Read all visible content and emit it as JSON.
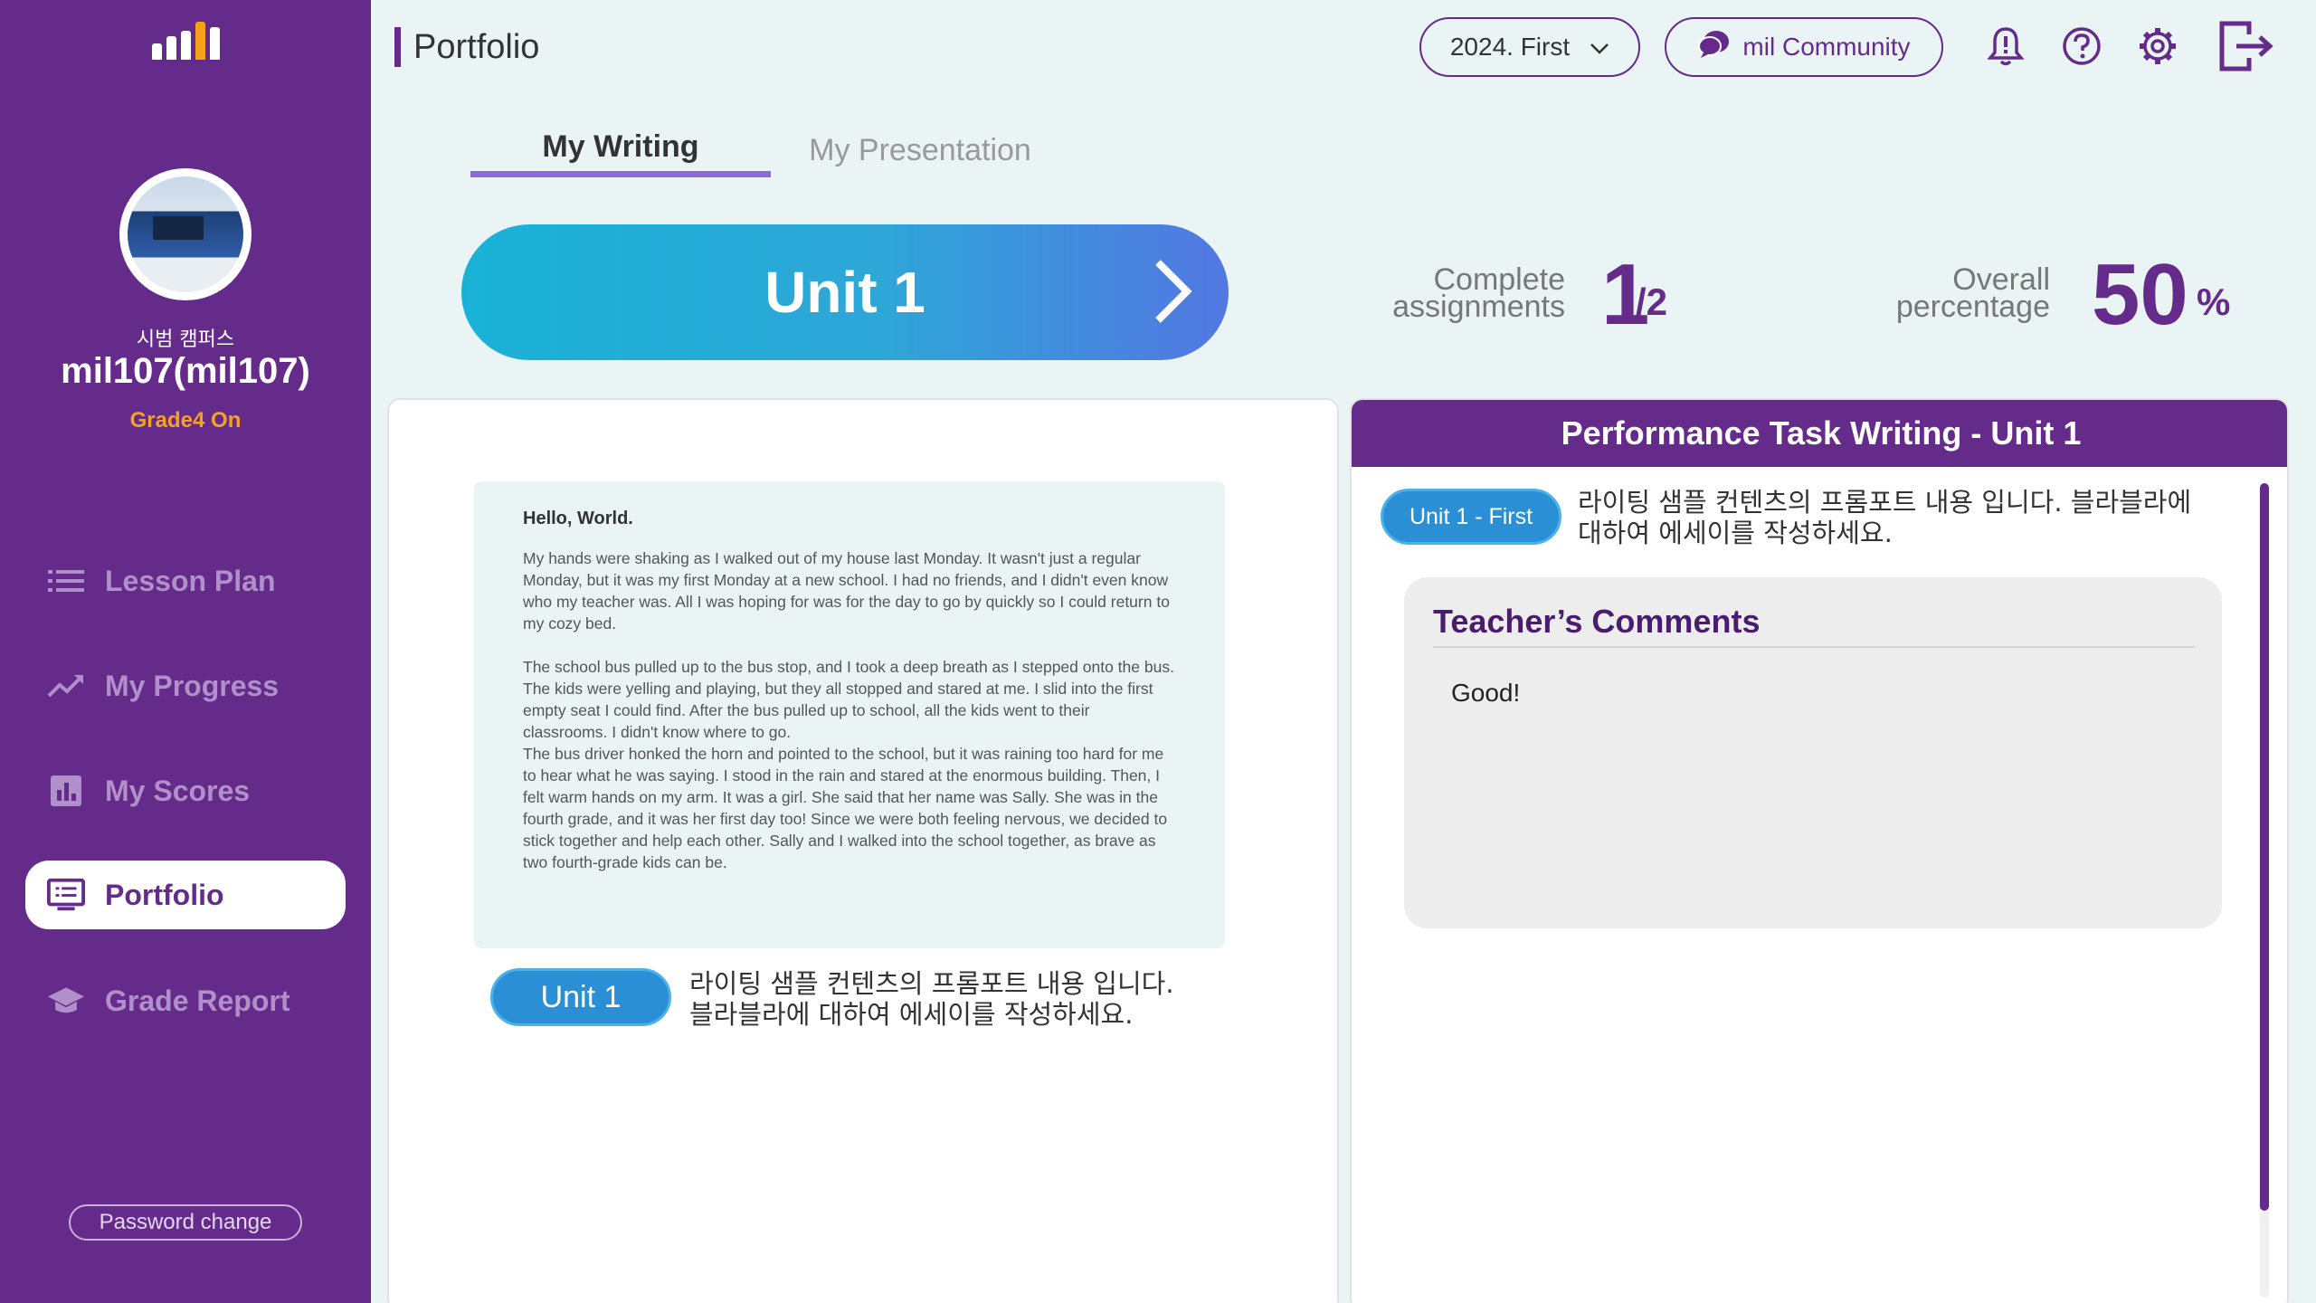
{
  "sidebar": {
    "campus": "시범 캠퍼스",
    "username": "mil107(mil107)",
    "grade": "Grade4 On",
    "nav": [
      {
        "label": "Lesson Plan",
        "icon": "list-icon"
      },
      {
        "label": "My Progress",
        "icon": "trend-up-icon"
      },
      {
        "label": "My Scores",
        "icon": "bar-chart-icon"
      },
      {
        "label": "Portfolio",
        "icon": "monitor-list-icon",
        "active": true
      },
      {
        "label": "Grade Report",
        "icon": "graduation-cap-icon"
      }
    ],
    "password_change": "Password change"
  },
  "header": {
    "title": "Portfolio",
    "semester": "2024. First",
    "community": "mil Community",
    "icons": [
      "bell-icon",
      "help-icon",
      "gear-icon",
      "logout-icon"
    ]
  },
  "tabs": [
    {
      "label": "My Writing",
      "active": true
    },
    {
      "label": "My Presentation",
      "active": false
    }
  ],
  "unit_banner": {
    "label": "Unit 1"
  },
  "stats": {
    "complete_label_line1": "Complete",
    "complete_label_line2": "assignments",
    "complete_done": "1",
    "complete_total": "/2",
    "overall_label_line1": "Overall",
    "overall_label_line2": "percentage",
    "overall_value": "50",
    "overall_unit": "%"
  },
  "essay": {
    "title": "Hello, World.",
    "paragraph1": "My hands were shaking as I walked out of my house last Monday. It wasn't just a regular Monday, but it was my first Monday at a new school. I had no friends, and I didn't even know who my teacher was. All I was hoping for was for the day to go by quickly so I could return to my cozy bed.",
    "paragraph2": "The school bus pulled up to the bus stop, and I took a deep breath as I stepped onto the bus. The kids were yelling and playing, but they all stopped and stared at me. I slid into the first empty seat I could find. After the bus pulled up to school, all the kids went to their classrooms. I didn't know where to go.\nThe bus driver honked the horn and pointed to the school, but it was raining too hard for me to hear what he was saying. I stood in the rain and stared at the enormous building. Then, I felt warm hands on my arm. It was a girl. She said that her name was Sally. She was in the fourth grade, and it was her first day too! Since we were both feeling nervous, we decided to stick together and help each other. Sally and I walked into the school together, as brave as two fourth-grade kids can be."
  },
  "left_footer": {
    "unit_pill": "Unit 1",
    "prompt": "라이팅 샘플 컨텐츠의 프롬포트 내용 입니다.\n블라블라에 대하여 에세이를 작성하세요."
  },
  "right_panel": {
    "title": "Performance Task Writing - Unit 1",
    "unit_pill": "Unit 1 - First",
    "prompt": "라이팅 샘플 컨텐츠의 프롬포트 내용 입니다. 블라블라에\n대하여 에세이를 작성하세요.",
    "comments_title": "Teacher’s Comments",
    "comments_body": "Good!"
  }
}
